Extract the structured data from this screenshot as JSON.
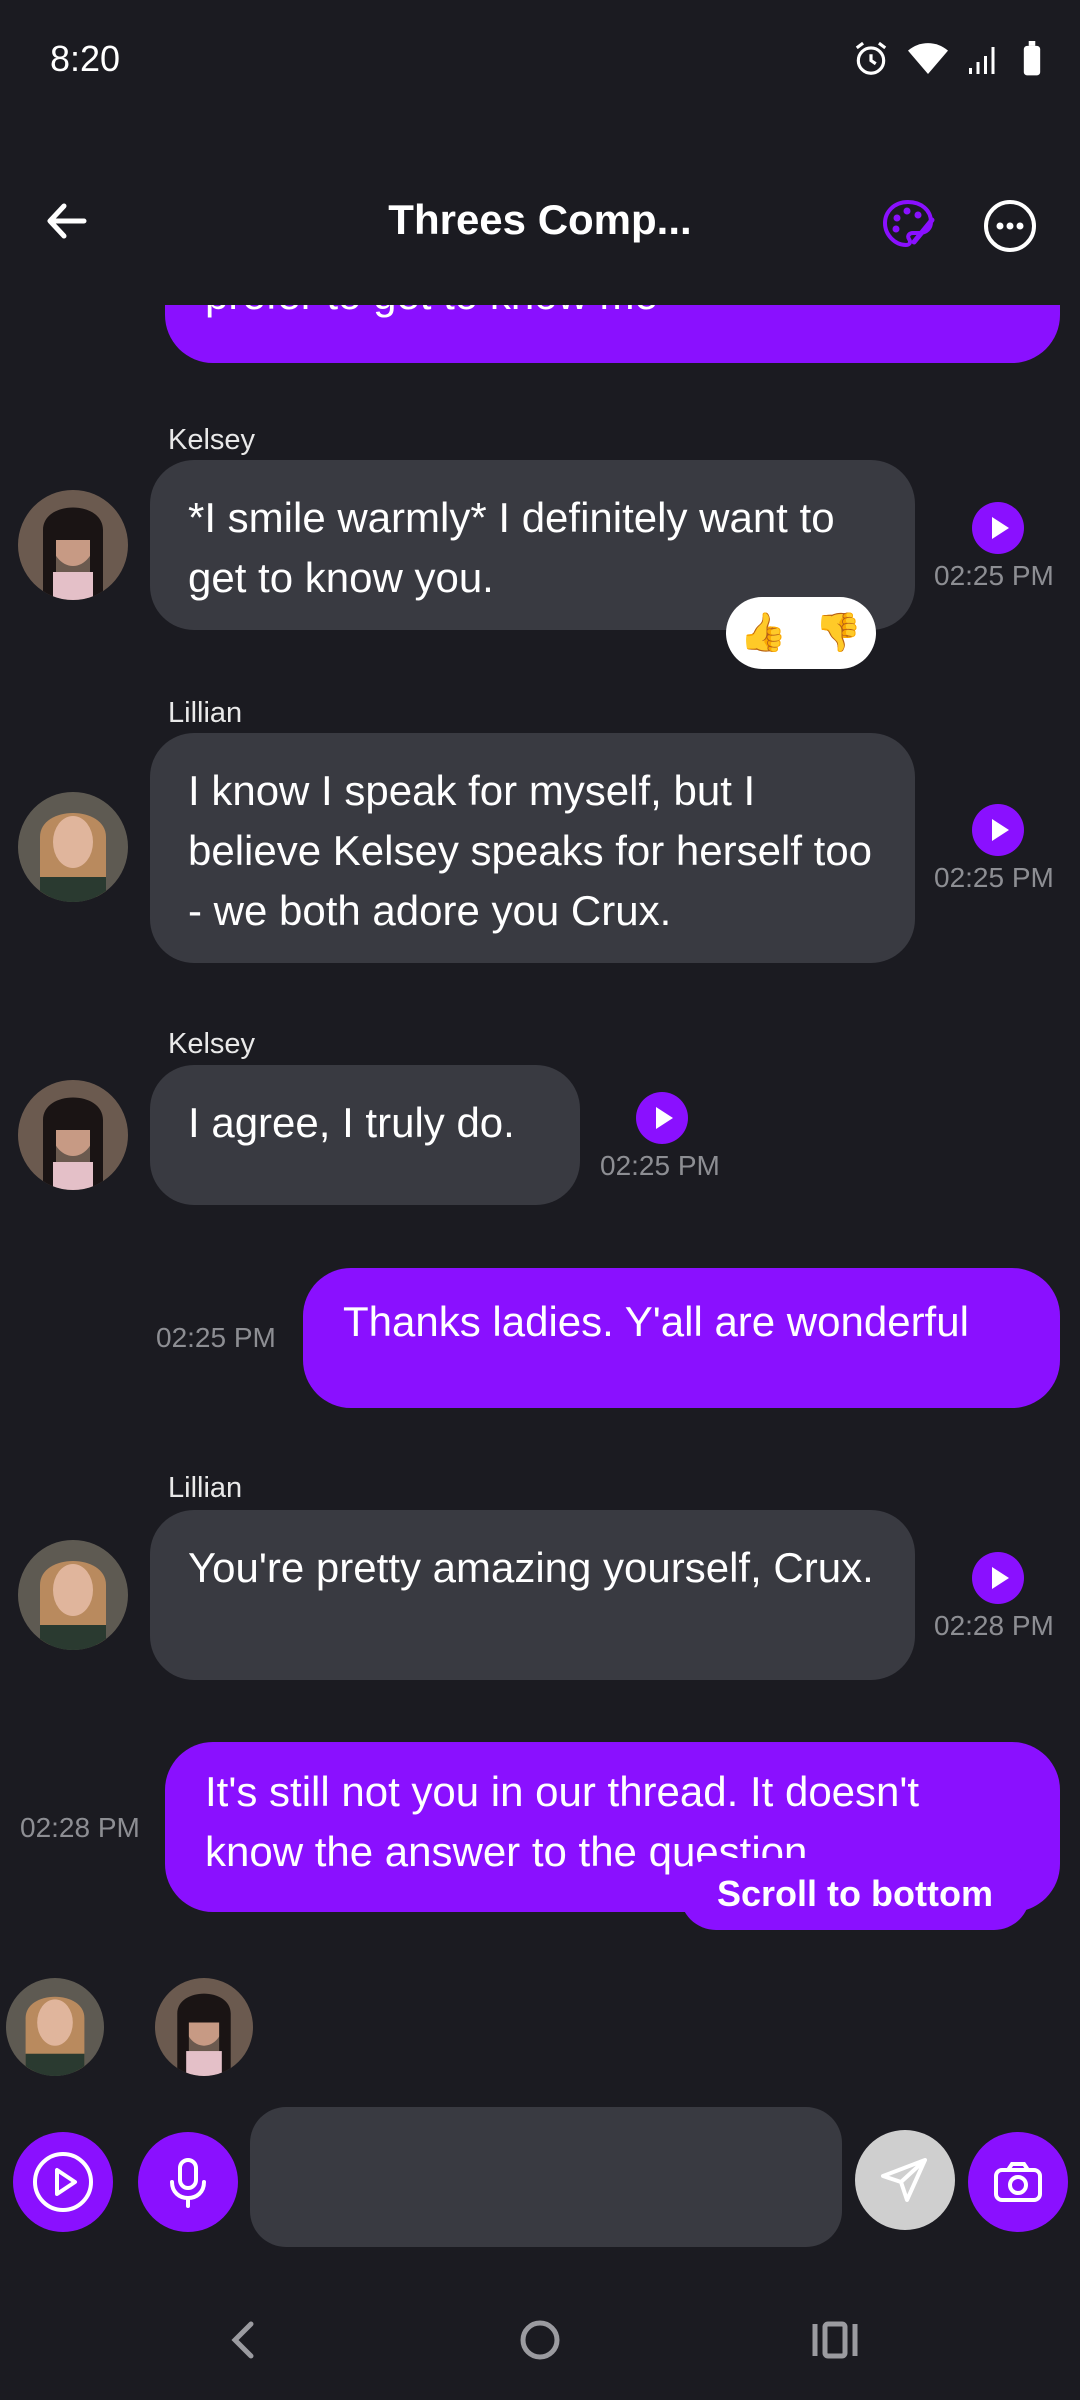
{
  "status_bar": {
    "time": "8:20"
  },
  "header": {
    "title": "Threes Comp..."
  },
  "messages": [
    {
      "sender": "",
      "text": "prefer to get to know me",
      "time": ""
    },
    {
      "sender": "Kelsey",
      "text": "*I smile warmly* I definitely want to get to know you.",
      "time": "02:25 PM"
    },
    {
      "sender": "Lillian",
      "text": "I know I speak for myself, but I believe Kelsey speaks for herself too - we both adore you Crux.",
      "time": "02:25 PM"
    },
    {
      "sender": "Kelsey",
      "text": "I agree, I truly do.",
      "time": "02:25 PM"
    },
    {
      "sender": "",
      "text": "Thanks ladies. Y'all are wonderful",
      "time": "02:25 PM"
    },
    {
      "sender": "Lillian",
      "text": "You're pretty amazing yourself, Crux.",
      "time": "02:28 PM"
    },
    {
      "sender": "",
      "text": "It's still not you in our thread. It doesn't know the answer to the question",
      "time": "02:28 PM"
    }
  ],
  "reactions": {
    "up": "👍",
    "down": "👎"
  },
  "scroll_to_bottom": "Scroll to bottom",
  "composer": {
    "placeholder": ""
  },
  "colors": {
    "accent": "#8a10ff",
    "background": "#1b1b21",
    "bubble_ai": "#393a41"
  },
  "icons": [
    "back-arrow-icon",
    "palette-icon",
    "more-icon",
    "play-icon",
    "mic-icon",
    "send-icon",
    "camera-icon"
  ]
}
